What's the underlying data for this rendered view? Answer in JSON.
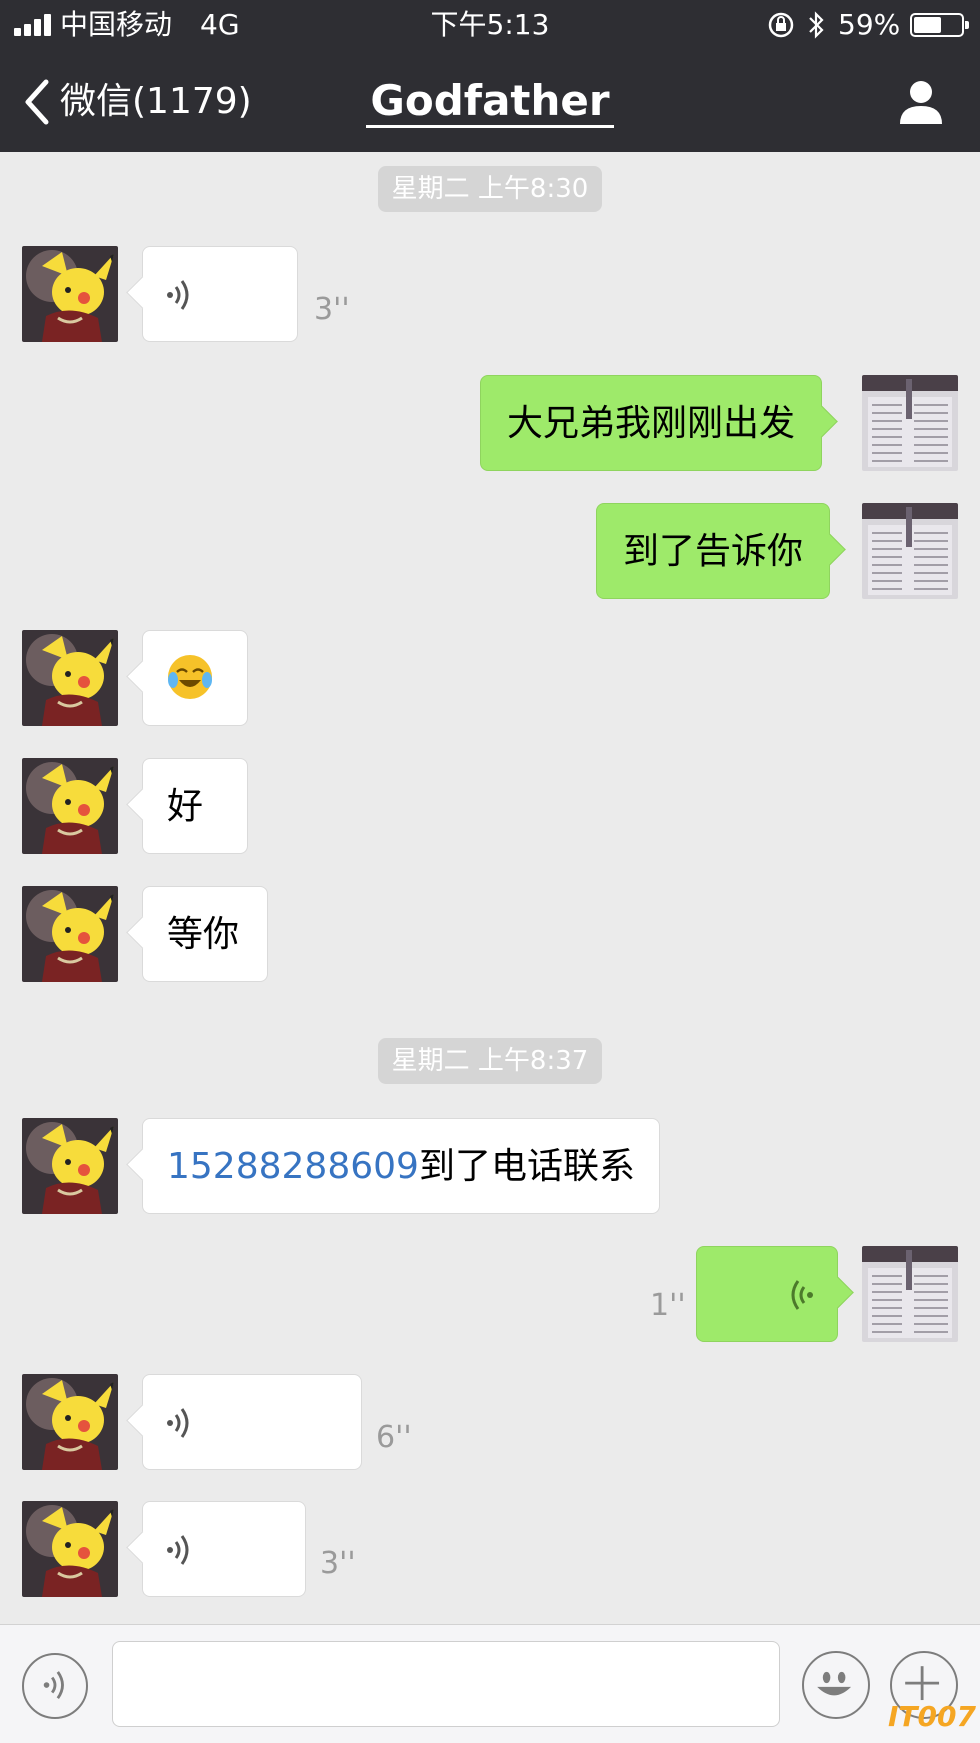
{
  "status_bar": {
    "carrier": "中国移动",
    "network": "4G",
    "time": "下午5:13",
    "battery_percent": "59%",
    "battery_level": 0.59
  },
  "nav": {
    "back_label": "微信(1179)",
    "title": "Godfather",
    "back_icon": "chevron-left-icon",
    "profile_icon": "person-icon"
  },
  "timestamps": [
    "星期二 上午8:30",
    "星期二 上午8:37"
  ],
  "messages": [
    {
      "side": "left",
      "type": "voice",
      "duration": "3''"
    },
    {
      "side": "right",
      "type": "text",
      "text": "大兄弟我刚刚出发"
    },
    {
      "side": "right",
      "type": "text",
      "text": "到了告诉你"
    },
    {
      "side": "left",
      "type": "emoji",
      "emoji": "laughing-crying-face-icon"
    },
    {
      "side": "left",
      "type": "text",
      "text": "好"
    },
    {
      "side": "left",
      "type": "text",
      "text": "等你"
    },
    {
      "side": "left",
      "type": "text_with_link",
      "link": "15288288609",
      "text": "到了电话联系"
    },
    {
      "side": "right",
      "type": "voice",
      "duration": "1''"
    },
    {
      "side": "left",
      "type": "voice",
      "duration": "6''"
    },
    {
      "side": "left",
      "type": "voice",
      "duration": "3''"
    }
  ],
  "input_bar": {
    "text_value": "",
    "voice_icon": "voice-toggle-icon",
    "emoji_icon": "smiley-icon",
    "plus_icon": "plus-icon"
  },
  "watermark": "IT007",
  "colors": {
    "header_bg": "#2e2e33",
    "chat_bg": "#ebebeb",
    "outgoing_bubble": "#9eea6a",
    "incoming_bubble": "#ffffff",
    "link": "#3774c2"
  }
}
